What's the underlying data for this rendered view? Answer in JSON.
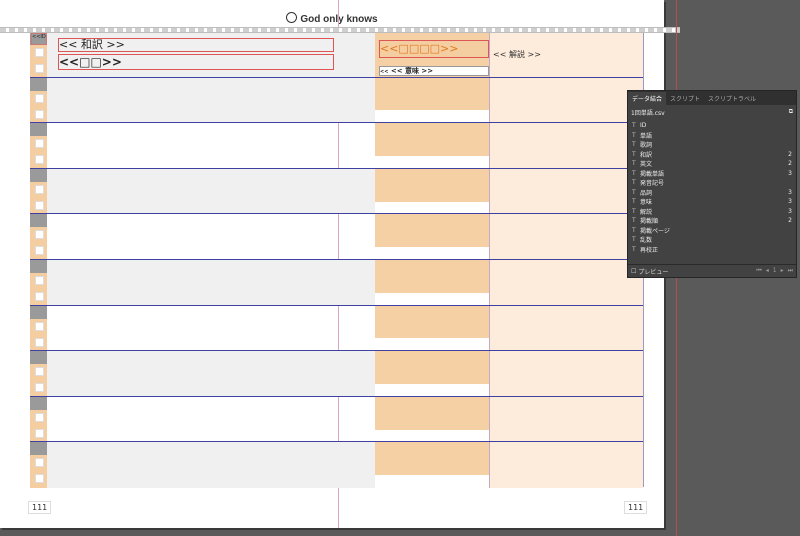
{
  "document": {
    "header_title": "God only knows",
    "page_number_left": "111",
    "page_number_right": "111"
  },
  "frames": {
    "label_small": "<<ID>>",
    "japanese_translation": "<< 和訳 >>",
    "word_placeholder": "<<□□>>",
    "headword_placeholder": "<<□□□□>>",
    "meaning": "<< 意味 >>",
    "meaning_prefix": "<<",
    "explanation": "<< 解説 >>"
  },
  "panel": {
    "tabs": [
      "データ結合",
      "スクリプト",
      "スクリプトラベル"
    ],
    "file_name": "1回単語.csv",
    "fields": [
      {
        "type": "T",
        "name": "ID",
        "count": ""
      },
      {
        "type": "T",
        "name": "単語",
        "count": ""
      },
      {
        "type": "T",
        "name": "歌詞",
        "count": ""
      },
      {
        "type": "T",
        "name": "和訳",
        "count": "2"
      },
      {
        "type": "T",
        "name": "英文",
        "count": "2"
      },
      {
        "type": "T",
        "name": "掲載単語",
        "count": "3"
      },
      {
        "type": "T",
        "name": "発音記号",
        "count": ""
      },
      {
        "type": "T",
        "name": "品詞",
        "count": "3"
      },
      {
        "type": "T",
        "name": "意味",
        "count": "3"
      },
      {
        "type": "T",
        "name": "解説",
        "count": "3"
      },
      {
        "type": "T",
        "name": "掲載順",
        "count": "2"
      },
      {
        "type": "T",
        "name": "掲載ページ",
        "count": ""
      },
      {
        "type": "T",
        "name": "乱数",
        "count": ""
      },
      {
        "type": "T",
        "name": "再校正",
        "count": ""
      }
    ],
    "preview_label": "プレビュー",
    "record_number": "1"
  },
  "colors": {
    "peach": "#f4d0a4",
    "light_peach": "#fdebdb",
    "row_line": "#4040a0",
    "frame_red": "#dd5555"
  }
}
